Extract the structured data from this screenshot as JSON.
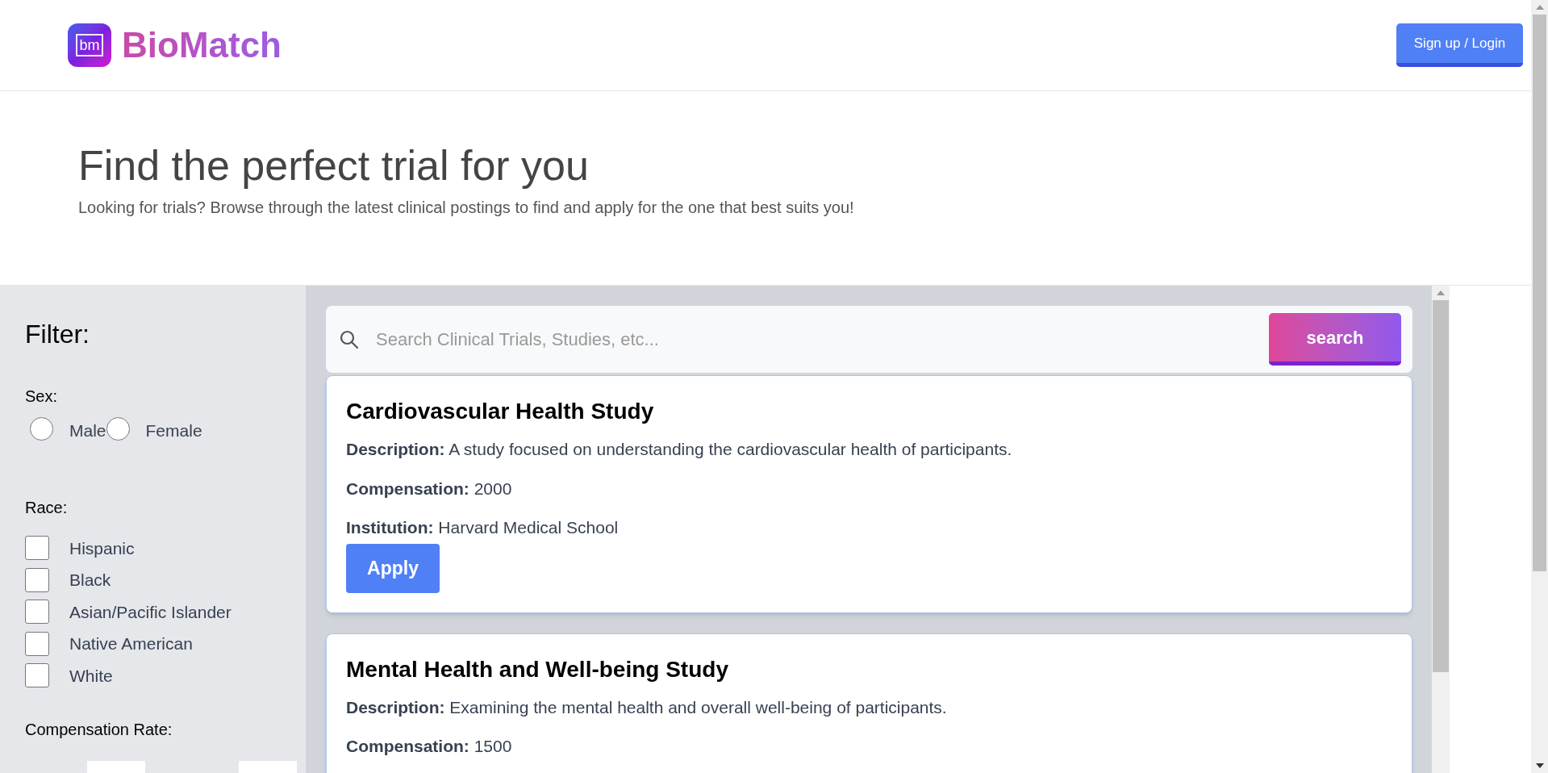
{
  "header": {
    "logo_mark": "bm",
    "brand": "BioMatch",
    "auth_button": "Sign up / Login"
  },
  "hero": {
    "title": "Find the perfect trial for you",
    "subtitle": "Looking for trials? Browse through the latest clinical postings to find and apply for the one that best suits you!"
  },
  "filter": {
    "title": "Filter:",
    "sex": {
      "label": "Sex:",
      "options": [
        {
          "label": "Male",
          "selected": false
        },
        {
          "label": "Female",
          "selected": false
        }
      ]
    },
    "race": {
      "label": "Race:",
      "options": [
        {
          "label": "Hispanic",
          "checked": false
        },
        {
          "label": "Black",
          "checked": false
        },
        {
          "label": "Asian/Pacific Islander",
          "checked": false
        },
        {
          "label": "Native American",
          "checked": false
        },
        {
          "label": "White",
          "checked": false
        }
      ]
    },
    "compensation": {
      "label": "Compensation Rate:"
    }
  },
  "search": {
    "placeholder": "Search Clinical Trials, Studies, etc...",
    "button": "search"
  },
  "trials": [
    {
      "title": "Cardiovascular Health Study",
      "lines": [
        "**Description:** A study focused on understanding the cardiovascular health of participants.",
        "**Compensation:** 2000",
        "**Institution:** Harvard Medical School"
      ],
      "button": "Apply"
    },
    {
      "title": "Mental Health and Well-being Study",
      "lines": [
        "**Description:** Examining the mental health and overall well-being of participants.",
        "**Compensation:** 1500"
      ]
    }
  ]
}
